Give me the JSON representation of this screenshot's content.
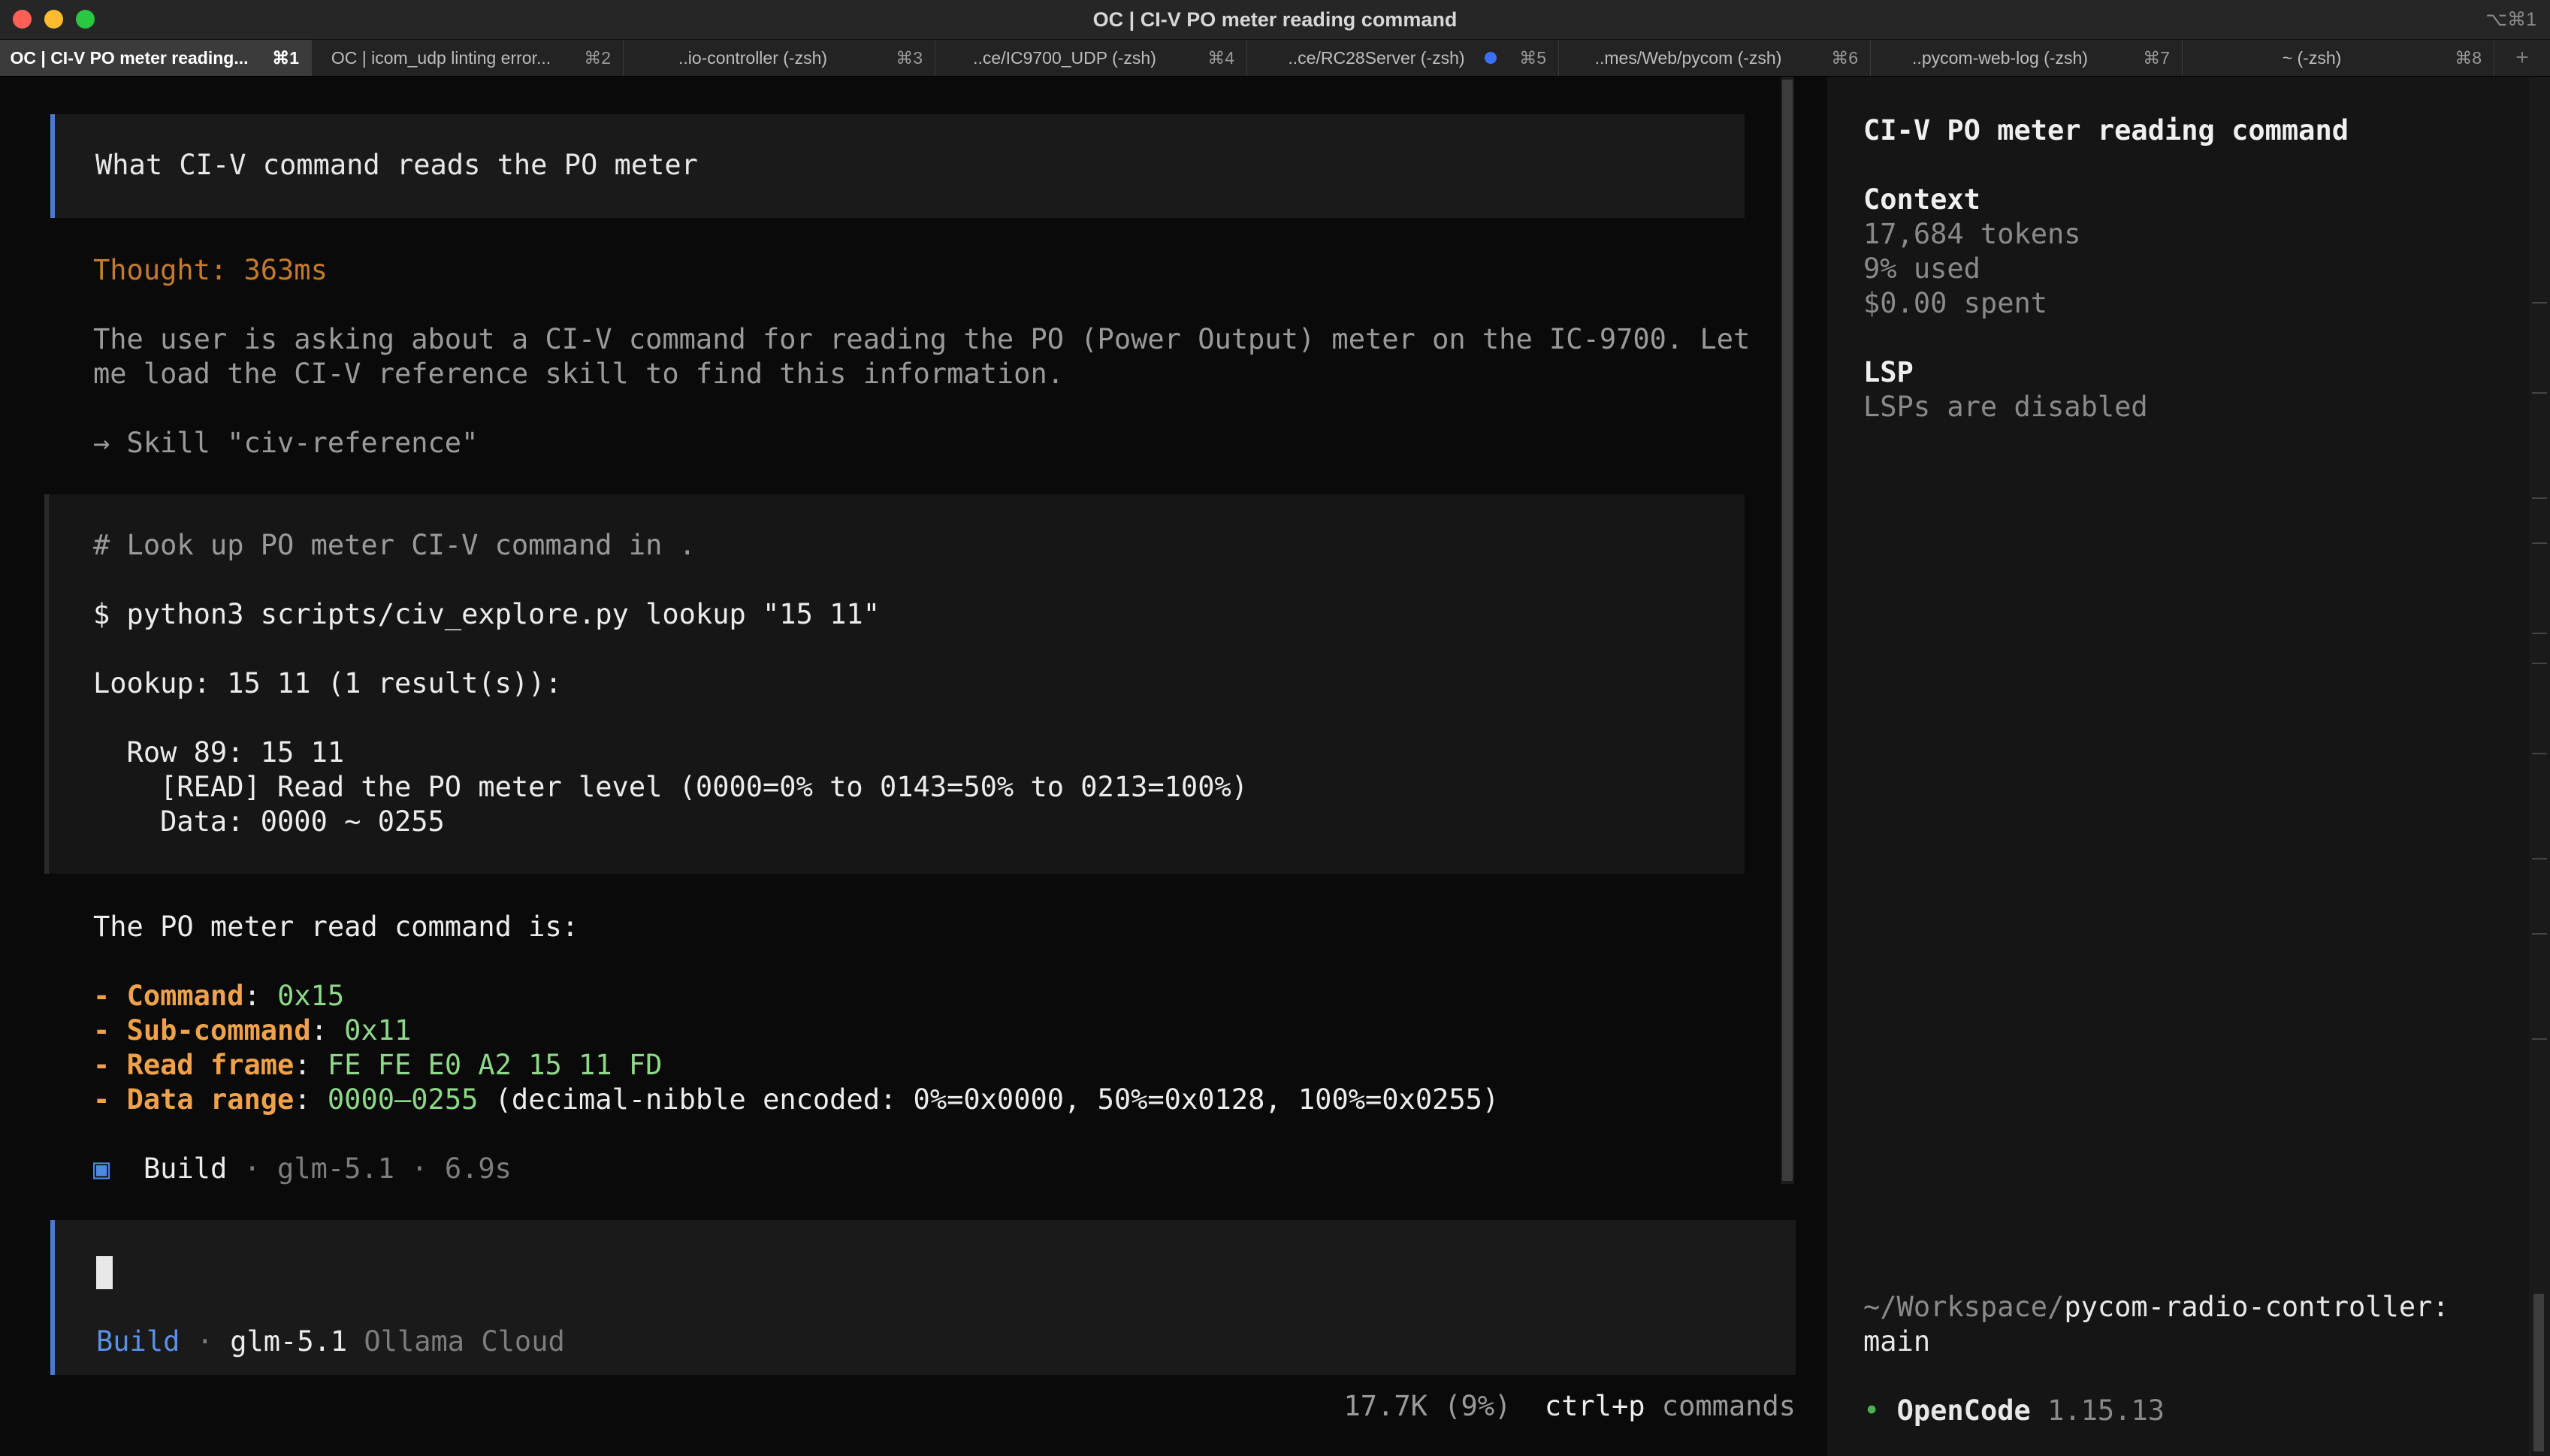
{
  "window": {
    "title": "OC | CI-V PO meter reading command",
    "shortcut": "⌥⌘1"
  },
  "tabs": [
    {
      "label": "OC | CI-V PO meter reading...",
      "key": "⌘1"
    },
    {
      "label": "OC | icom_udp linting error...",
      "key": "⌘2"
    },
    {
      "label": "..io-controller (-zsh)",
      "key": "⌘3"
    },
    {
      "label": "..ce/IC9700_UDP (-zsh)",
      "key": "⌘4"
    },
    {
      "label": "..ce/RC28Server (-zsh)",
      "key": "⌘5"
    },
    {
      "label": "..mes/Web/pycom (-zsh)",
      "key": "⌘6"
    },
    {
      "label": "..pycom-web-log (-zsh)",
      "key": "⌘7"
    },
    {
      "label": "~ (-zsh)",
      "key": "⌘8"
    }
  ],
  "tab_add": "+",
  "conversation": {
    "user_message": "What CI-V command reads the PO meter",
    "thought": "Thought: 363ms",
    "reasoning_line1": "The user is asking about a CI-V command for reading the PO (Power Output) meter on the IC-9700. Let",
    "reasoning_line2": "me load the CI-V reference skill to find this information.",
    "skill_call": "→ Skill \"civ-reference\"",
    "tool": {
      "comment": "# Look up PO meter CI-V command in .",
      "command": "$ python3 scripts/civ_explore.py lookup \"15 11\"",
      "lookup": "Lookup: 15 11 (1 result(s)):",
      "row": "  Row 89: 15 11",
      "read": "    [READ] Read the PO meter level (0000=0% to 0143=50% to 0213=100%)",
      "data": "    Data: 0000 ~ 0255"
    },
    "answer_intro": "The PO meter read command is:",
    "items": [
      {
        "key": "Command",
        "value": "0x15",
        "extra": ""
      },
      {
        "key": "Sub-command",
        "value": "0x11",
        "extra": ""
      },
      {
        "key": "Read frame",
        "value": "FE FE E0 A2 15 11 FD",
        "extra": ""
      },
      {
        "key": "Data range",
        "value": "0000–0255",
        "extra": " (decimal-nibble encoded: 0%=0x0000, 50%=0x0128, 100%=0x0255)"
      }
    ],
    "bullet": "- ",
    "sep": ": ",
    "footer": {
      "icon": "▣",
      "agent": "Build",
      "meta": " · glm-5.1 · 6.9s"
    }
  },
  "input": {
    "agent": "Build",
    "dot": " · ",
    "model": "glm-5.1",
    "provider": " Ollama Cloud"
  },
  "status": {
    "tokens": "17.7K (9%)",
    "shortcut": "ctrl+p",
    "commands": " commands"
  },
  "sidebar": {
    "title": "CI-V PO meter reading command",
    "context_heading": "Context",
    "tokens": "17,684 tokens",
    "used": "9% used",
    "spent": "$0.00 spent",
    "lsp_heading": "LSP",
    "lsp_status": "LSPs are disabled",
    "path_prefix": "~/Workspace/",
    "path_repo": "pycom-radio-controller:",
    "branch": "main",
    "bullet": "•",
    "app_name": "OpenCode",
    "version": "1.15.13"
  },
  "colors": {
    "accent_blue": "#4d79d6",
    "thought_orange": "#c47b2e",
    "key_orange": "#f0a24a",
    "value_green": "#8ed88a",
    "status_green": "#4caf50"
  }
}
